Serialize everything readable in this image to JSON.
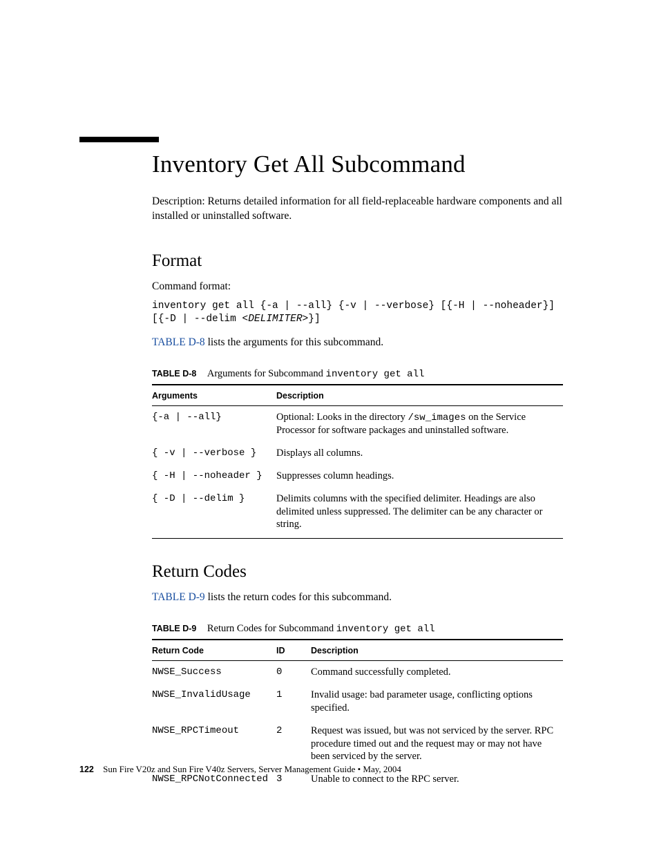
{
  "heading": "Inventory Get All Subcommand",
  "intro": "Description: Returns detailed information for all field-replaceable hardware components and all installed or uninstalled software.",
  "format": {
    "title": "Format",
    "leadin": "Command format:",
    "code_line1": "inventory get all {-a | --all} {-v | --verbose} [{-H | --noheader}]",
    "code_line2_prefix": "[{-D | --delim ",
    "code_line2_italic": "<DELIMITER>",
    "code_line2_suffix": "}]",
    "ref_link": "TABLE D-8",
    "ref_rest": " lists the arguments for this subcommand."
  },
  "table_d8": {
    "label": "TABLE D-8",
    "title_prefix": "Arguments for Subcommand ",
    "title_code": "inventory get all",
    "headers": {
      "arguments": "Arguments",
      "description": "Description"
    },
    "rows": [
      {
        "arg": "{-a | --all}",
        "desc_pre": "Optional: Looks in the directory ",
        "desc_code": "/sw_images",
        "desc_post": " on the Service Processor for software packages and uninstalled software."
      },
      {
        "arg": "{ -v | --verbose }",
        "desc": "Displays all columns."
      },
      {
        "arg": "{ -H | --noheader }",
        "desc": "Suppresses column headings."
      },
      {
        "arg": "{ -D | --delim }",
        "desc": "Delimits columns with the specified delimiter. Headings are also delimited unless suppressed. The delimiter can be any character or string."
      }
    ]
  },
  "returncodes": {
    "title": "Return Codes",
    "ref_link": "TABLE D-9",
    "ref_rest": " lists the return codes for this subcommand."
  },
  "table_d9": {
    "label": "TABLE D-9",
    "title_prefix": "Return Codes for Subcommand ",
    "title_code": "inventory get all",
    "headers": {
      "code": "Return Code",
      "id": "ID",
      "description": "Description"
    },
    "rows": [
      {
        "code": "NWSE_Success",
        "id": "0",
        "desc": "Command successfully completed."
      },
      {
        "code": "NWSE_InvalidUsage",
        "id": "1",
        "desc": "Invalid usage: bad parameter usage, conflicting options specified."
      },
      {
        "code": "NWSE_RPCTimeout",
        "id": "2",
        "desc": "Request was issued, but was not serviced by the server. RPC procedure timed out and the request may or may not have been serviced by the server."
      },
      {
        "code": "NWSE_RPCNotConnected",
        "id": "3",
        "desc": "Unable to connect to the RPC server."
      }
    ]
  },
  "footer": {
    "page_number": "122",
    "text": "Sun Fire V20z and Sun Fire V40z Servers, Server Management Guide • May, 2004"
  }
}
